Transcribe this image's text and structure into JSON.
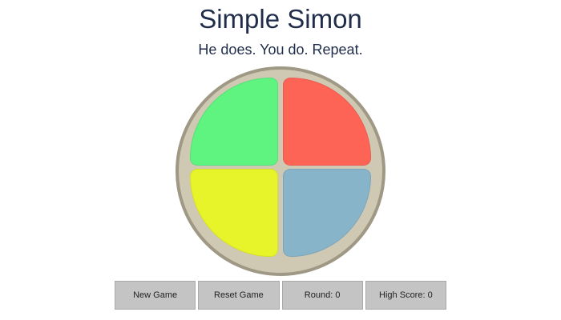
{
  "header": {
    "title": "Simple Simon",
    "subtitle": "He does. You do. Repeat."
  },
  "board": {
    "pads": [
      {
        "name": "green",
        "color": "#5ef47f"
      },
      {
        "name": "red",
        "color": "#fd6456"
      },
      {
        "name": "yellow",
        "color": "#e8f42a"
      },
      {
        "name": "blue",
        "color": "#88b4c9"
      }
    ],
    "ring_color": "#cfc9b4",
    "rim_color": "#9e9884"
  },
  "controls": {
    "new_game_label": "New Game",
    "reset_game_label": "Reset Game",
    "round_text": "Round: 0",
    "high_score_text": "High Score: 0"
  }
}
